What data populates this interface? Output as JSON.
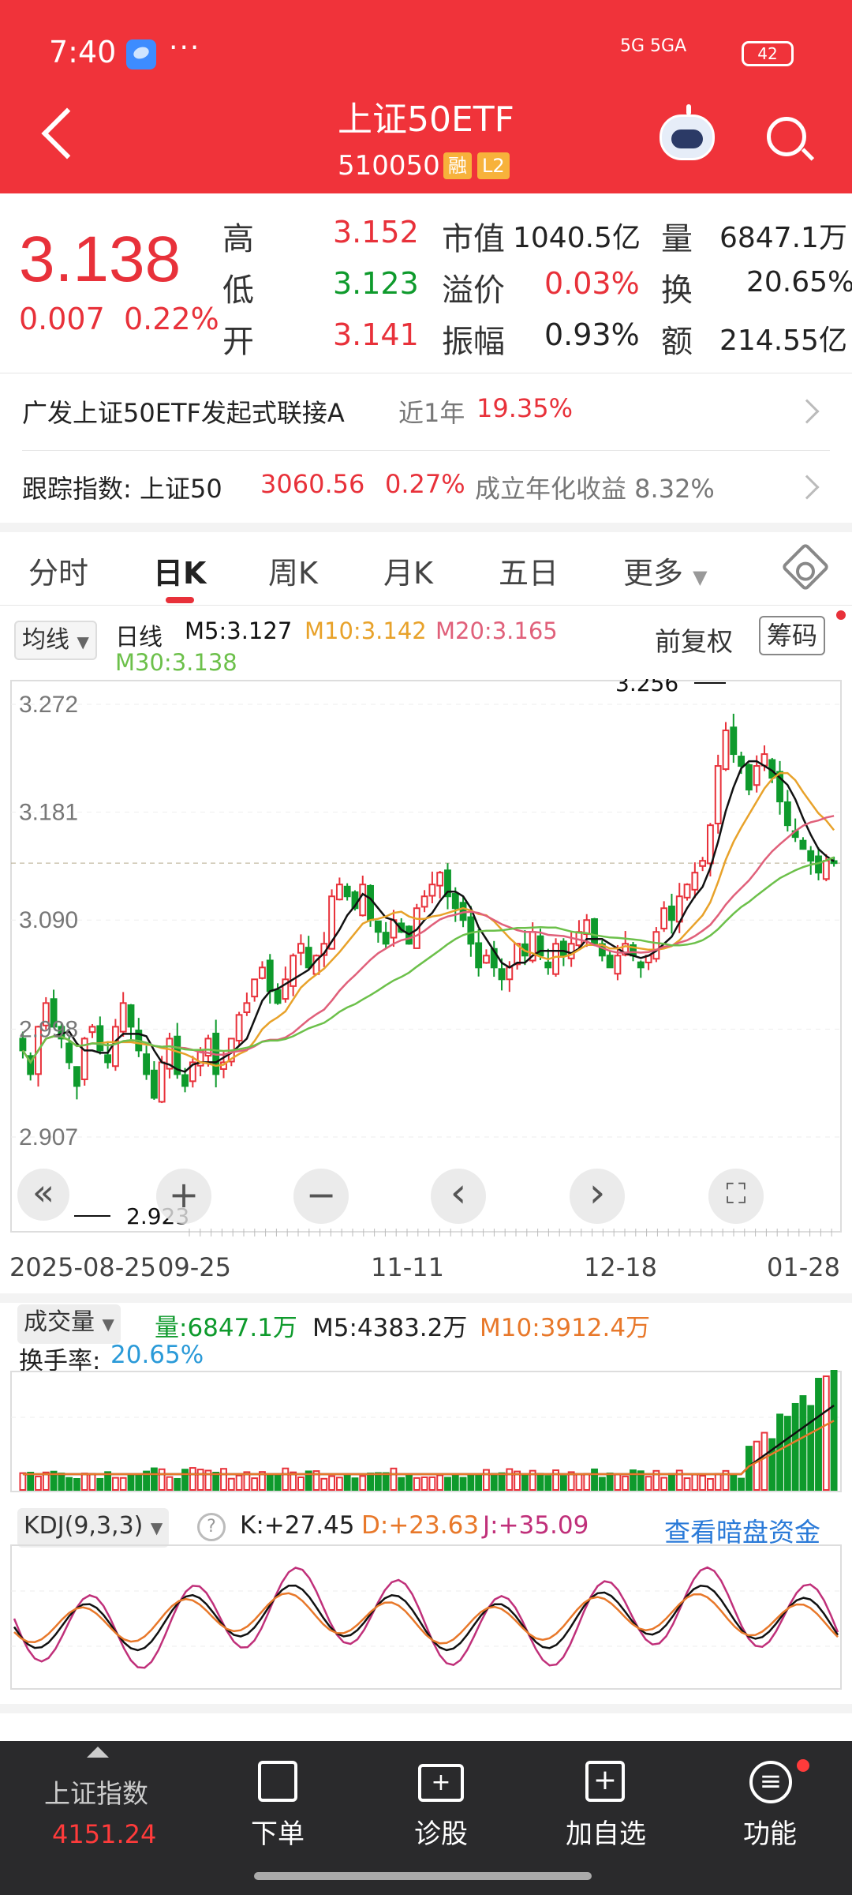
{
  "status": {
    "time": "7:40",
    "dots": "···",
    "network": "5G  5GA",
    "battery": "42"
  },
  "header": {
    "title": "上证50ETF",
    "code": "510050",
    "tag_margin": "融",
    "tag_level": "L2"
  },
  "quote": {
    "price": "3.138",
    "change": "0.007",
    "change_pct": "0.22%",
    "high_label": "高",
    "high": "3.152",
    "low_label": "低",
    "low": "3.123",
    "open_label": "开",
    "open": "3.141",
    "mcap_label": "市值",
    "mcap": "1040.5亿",
    "premium_label": "溢价",
    "premium": "0.03%",
    "amplitude_label": "振幅",
    "amplitude": "0.93%",
    "volume_label": "量",
    "volume": "6847.1万",
    "turnover_label": "换",
    "turnover": "20.65%",
    "amount_label": "额",
    "amount": "214.55亿"
  },
  "fund_row": {
    "name": "广发上证50ETF发起式联接A",
    "period": "近1年",
    "return": "19.35%"
  },
  "index_row": {
    "label": "跟踪指数: 上证50",
    "value": "3060.56",
    "pct": "0.27%",
    "since": "成立年化收益 8.32%"
  },
  "tabs": [
    "分时",
    "日K",
    "周K",
    "月K",
    "五日",
    "更多"
  ],
  "kline": {
    "selector": "均线",
    "period": "日线",
    "ma5": "M5:3.127",
    "ma10": "M10:3.142",
    "ma20": "M20:3.165",
    "ma30": "M30:3.138",
    "adjust": "前复权",
    "chips": "筹码",
    "y_labels": [
      "3.272",
      "3.181",
      "3.090",
      "2.998",
      "2.907"
    ],
    "high_mark": "3.256",
    "low_mark": "2.923",
    "x_labels": [
      "2025-08-25",
      "09-25",
      "11-11",
      "12-18",
      "01-28"
    ],
    "ctrl": [
      "«",
      "+",
      "−",
      "‹",
      "›",
      "⛶"
    ]
  },
  "volume": {
    "selector": "成交量",
    "vol": "量:6847.1万",
    "m5": "M5:4383.2万",
    "m10": "M10:3912.4万",
    "turnover_label": "换手率:",
    "turnover": "20.65%"
  },
  "kdj": {
    "selector": "KDJ(9,3,3)",
    "help": "?",
    "k": "K:+27.45",
    "d": "D:+23.63",
    "j": "J:+35.09",
    "link": "查看暗盘资金"
  },
  "bottom_nav": {
    "index_name": "上证指数",
    "index_value": "4151.24",
    "items": [
      "下单",
      "诊股",
      "加自选",
      "功能"
    ]
  },
  "colors": {
    "red": "#e8313a",
    "green": "#0e9a2c",
    "ma5": "#111111",
    "ma10": "#e8a22a",
    "ma20": "#e0607a",
    "ma30": "#6cc04a"
  },
  "chart_data": {
    "type": "candlestick",
    "x_labels": [
      "2025-08-25",
      "09-25",
      "11-11",
      "12-18",
      "01-28"
    ],
    "y_ticks": [
      3.272,
      3.181,
      3.09,
      2.998,
      2.907
    ],
    "ylim": [
      2.907,
      3.272
    ],
    "close": [
      2.98,
      2.96,
      3.0,
      3.02,
      3.0,
      2.99,
      2.97,
      2.95,
      2.99,
      3.0,
      2.98,
      2.97,
      3.0,
      3.02,
      3.0,
      2.98,
      2.96,
      2.94,
      2.97,
      2.99,
      2.96,
      2.95,
      2.97,
      2.98,
      2.99,
      2.96,
      2.97,
      2.99,
      3.01,
      3.02,
      3.04,
      3.05,
      3.03,
      3.02,
      3.04,
      3.06,
      3.07,
      3.05,
      3.06,
      3.07,
      3.11,
      3.12,
      3.11,
      3.1,
      3.12,
      3.09,
      3.08,
      3.07,
      3.09,
      3.08,
      3.07,
      3.1,
      3.11,
      3.12,
      3.13,
      3.11,
      3.1,
      3.09,
      3.07,
      3.05,
      3.06,
      3.05,
      3.04,
      3.05,
      3.07,
      3.06,
      3.08,
      3.06,
      3.05,
      3.07,
      3.06,
      3.07,
      3.08,
      3.09,
      3.07,
      3.06,
      3.05,
      3.06,
      3.07,
      3.06,
      3.05,
      3.06,
      3.08,
      3.1,
      3.09,
      3.11,
      3.12,
      3.13,
      3.14,
      3.17,
      3.22,
      3.25,
      3.23,
      3.22,
      3.2,
      3.22,
      3.23,
      3.21,
      3.19,
      3.17,
      3.16,
      3.15,
      3.14,
      3.13,
      3.14,
      3.138
    ],
    "volume_note": "daily volume bars; last bars spike",
    "kdj_k": 27.45,
    "kdj_d": 23.63,
    "kdj_j": 35.09
  }
}
